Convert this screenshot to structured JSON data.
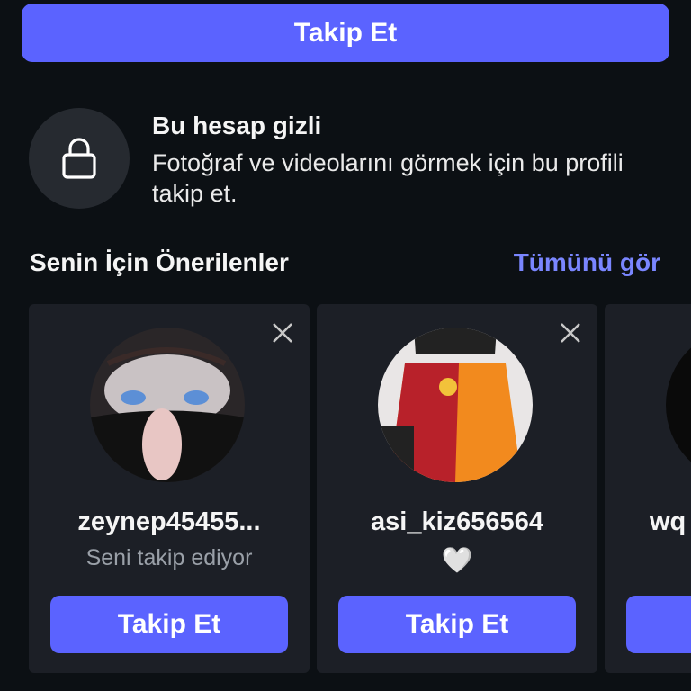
{
  "header": {
    "follow_label": "Takip Et"
  },
  "private_notice": {
    "title": "Bu hesap gizli",
    "description": "Fotoğraf ve videolarını görmek için bu profili takip et."
  },
  "suggestions": {
    "title": "Senin İçin Önerilenler",
    "see_all": "Tümünü gör",
    "cards": [
      {
        "username": "zeynep45455...",
        "subtitle": "Seni takip ediyor",
        "follow_label": "Takip Et"
      },
      {
        "username": "asi_kiz656564",
        "subtitle": "🤍",
        "follow_label": "Takip Et"
      },
      {
        "username": "wq",
        "subtitle": "",
        "follow_label": ""
      }
    ]
  },
  "colors": {
    "accent": "#5b63ff",
    "link": "#7a86ff",
    "background": "#0c1014",
    "card": "#1c1f26"
  }
}
